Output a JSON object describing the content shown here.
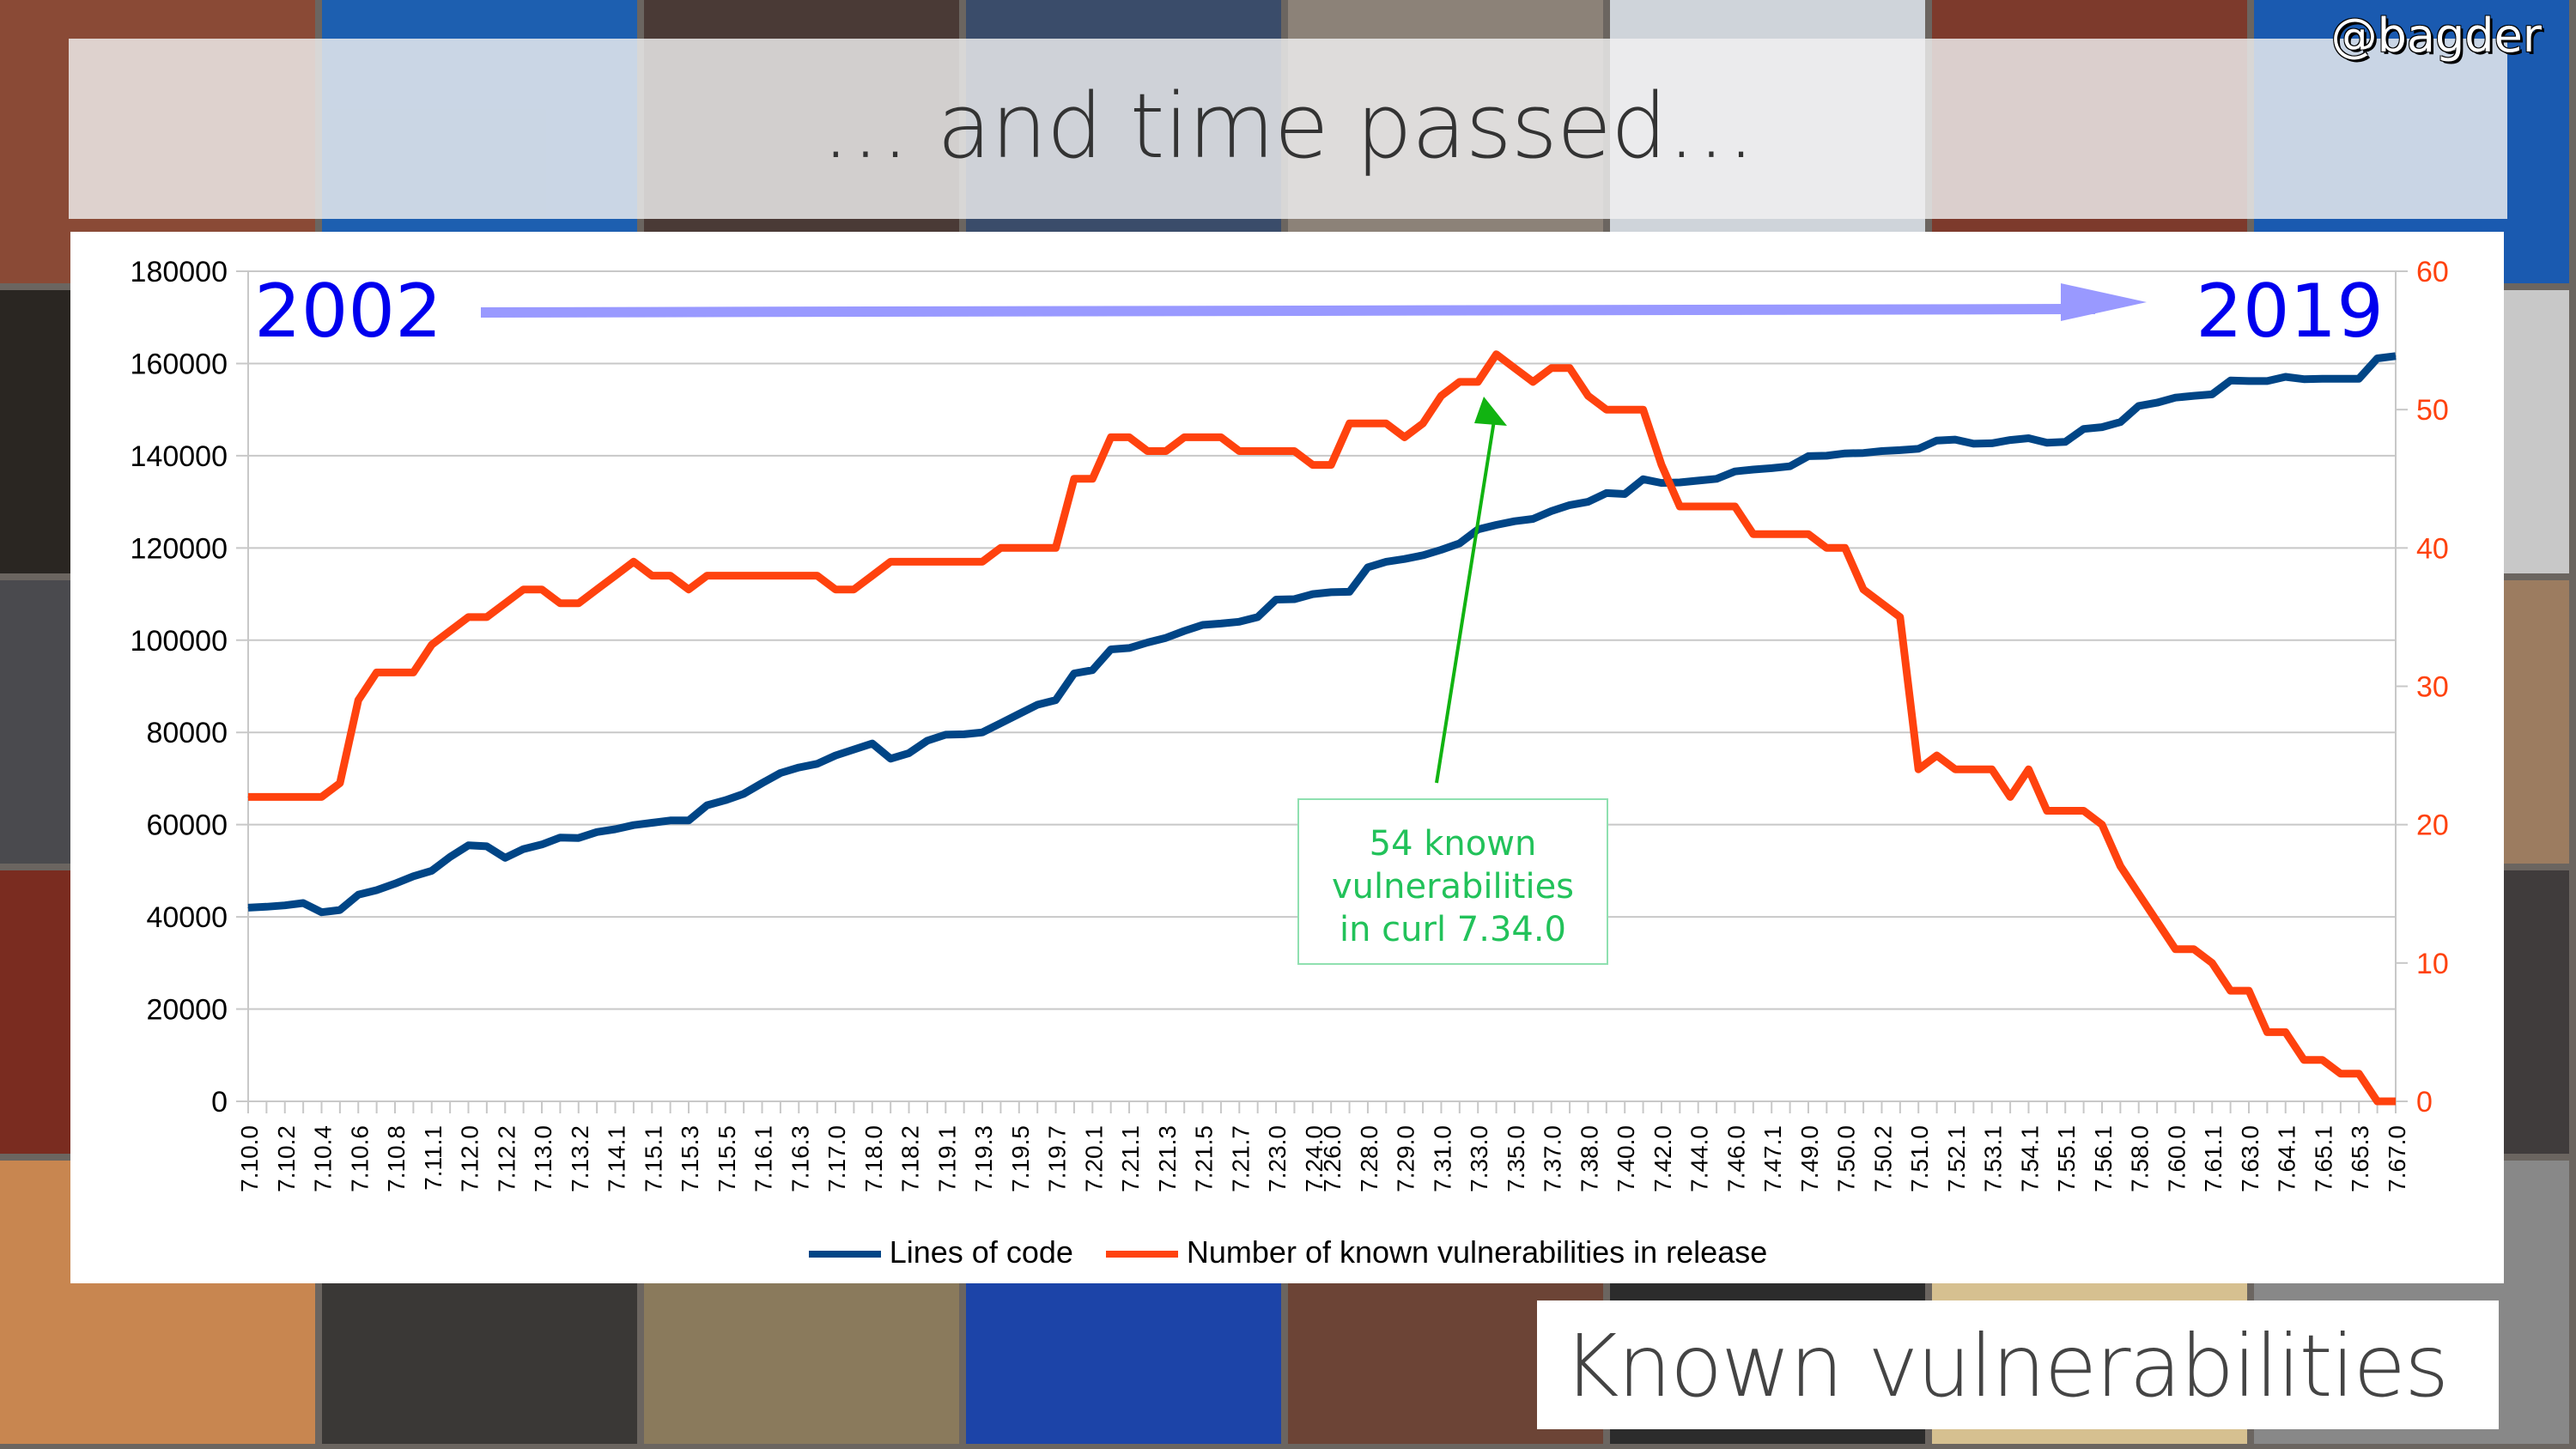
{
  "slide": {
    "title": "… and time passed…",
    "handle": "@bagder",
    "footer_title": "Known vulnerabilities",
    "start_year": "2002",
    "end_year": "2019",
    "annotation": [
      "54 known",
      "vulnerabilities",
      "in curl 7.34.0"
    ]
  },
  "colors": {
    "lines_of_code": "#004586",
    "vulnerabilities": "#ff420e",
    "annotation": "#22c25a",
    "year_text": "#0000ee",
    "year_arrow": "#9999ff",
    "right_axis": "#ff420e"
  },
  "chart_data": {
    "type": "line",
    "title": "",
    "xlabel": "",
    "ylabel": "",
    "y_left": {
      "range": [
        0,
        180000
      ],
      "ticks": [
        0,
        20000,
        40000,
        60000,
        80000,
        100000,
        120000,
        140000,
        160000,
        180000
      ]
    },
    "y_right": {
      "range": [
        0,
        60
      ],
      "ticks": [
        0,
        10,
        20,
        30,
        40,
        50,
        60
      ]
    },
    "grid": true,
    "legend_position": "bottom",
    "x_tick_labels": [
      "7.10.0",
      "7.10.2",
      "7.10.4",
      "7.10.6",
      "7.10.8",
      "7.11.1",
      "7.12.0",
      "7.12.2",
      "7.13.0",
      "7.13.2",
      "7.14.1",
      "7.15.1",
      "7.15.3",
      "7.15.5",
      "7.16.1",
      "7.16.3",
      "7.17.0",
      "7.18.0",
      "7.18.2",
      "7.19.1",
      "7.19.3",
      "7.19.5",
      "7.19.7",
      "7.20.1",
      "7.21.1",
      "7.21.3",
      "7.21.5",
      "7.21.7",
      "7.23.0",
      "7.24.0",
      "7.26.0",
      "7.28.0",
      "7.29.0",
      "7.31.0",
      "7.33.0",
      "7.35.0",
      "7.37.0",
      "7.38.0",
      "7.40.0",
      "7.42.0",
      "7.44.0",
      "7.46.0",
      "7.47.1",
      "7.49.0",
      "7.50.0",
      "7.50.2",
      "7.51.0",
      "7.52.1",
      "7.53.1",
      "7.54.1",
      "7.55.1",
      "7.56.1",
      "7.58.0",
      "7.60.0",
      "7.61.1",
      "7.63.0",
      "7.64.1",
      "7.65.1",
      "7.65.3",
      "7.67.0"
    ],
    "series": [
      {
        "name": "Lines of code",
        "axis": "left",
        "values": [
          42000,
          42200,
          42500,
          43000,
          41000,
          41500,
          44800,
          45800,
          47200,
          48800,
          50000,
          53000,
          55500,
          55300,
          52800,
          54700,
          55700,
          57200,
          57100,
          58400,
          59000,
          59900,
          60400,
          60900,
          60900,
          64200,
          65300,
          66700,
          69000,
          71200,
          72400,
          73200,
          75000,
          76300,
          77600,
          74300,
          75500,
          78200,
          79500,
          79600,
          80000,
          82000,
          84000,
          86000,
          87000,
          92800,
          93500,
          98000,
          98300,
          99500,
          100500,
          102000,
          103300,
          103600,
          104000,
          105000,
          108800,
          108900,
          110000,
          110400,
          110500,
          115800,
          117000,
          117600,
          118400,
          119600,
          121000,
          124000,
          125000,
          125800,
          126300,
          128000,
          129300,
          130000,
          131900,
          131700,
          134900,
          134100,
          134200,
          134600,
          135000,
          136600,
          137000,
          137300,
          137700,
          139900,
          140000,
          140500,
          140600,
          141000,
          141200,
          141500,
          143300,
          143500,
          142600,
          142700,
          143400,
          143800,
          142800,
          143000,
          145800,
          146200,
          147300,
          150800,
          151500,
          152600,
          153000,
          153300,
          156300,
          156200,
          156200,
          157100,
          156600,
          156700,
          156700,
          156700,
          161100,
          161600
        ]
      },
      {
        "name": "Number of known vulnerabilities in release",
        "axis": "right",
        "values": [
          22,
          22,
          22,
          22,
          22,
          23,
          29,
          31,
          31,
          31,
          33,
          34,
          35,
          35,
          36,
          37,
          37,
          36,
          36,
          37,
          38,
          39,
          38,
          38,
          37,
          38,
          38,
          38,
          38,
          38,
          38,
          38,
          37,
          37,
          38,
          39,
          39,
          39,
          39,
          39,
          39,
          40,
          40,
          40,
          40,
          45,
          45,
          48,
          48,
          47,
          47,
          48,
          48,
          48,
          47,
          47,
          47,
          47,
          46,
          46,
          49,
          49,
          49,
          48,
          49,
          51,
          52,
          52,
          54,
          53,
          52,
          53,
          53,
          51,
          50,
          50,
          50,
          46,
          43,
          43,
          43,
          43,
          41,
          41,
          41,
          41,
          40,
          40,
          37,
          36,
          35,
          24,
          25,
          24,
          24,
          24,
          22,
          24,
          21,
          21,
          21,
          20,
          17,
          15,
          13,
          11,
          11,
          10,
          8,
          8,
          5,
          5,
          3,
          3,
          2,
          2,
          0,
          0
        ]
      }
    ],
    "annotations": [
      {
        "text": "54 known vulnerabilities in curl 7.34.0",
        "points_to": {
          "series": "Number of known vulnerabilities in release",
          "value": 54
        }
      }
    ]
  }
}
